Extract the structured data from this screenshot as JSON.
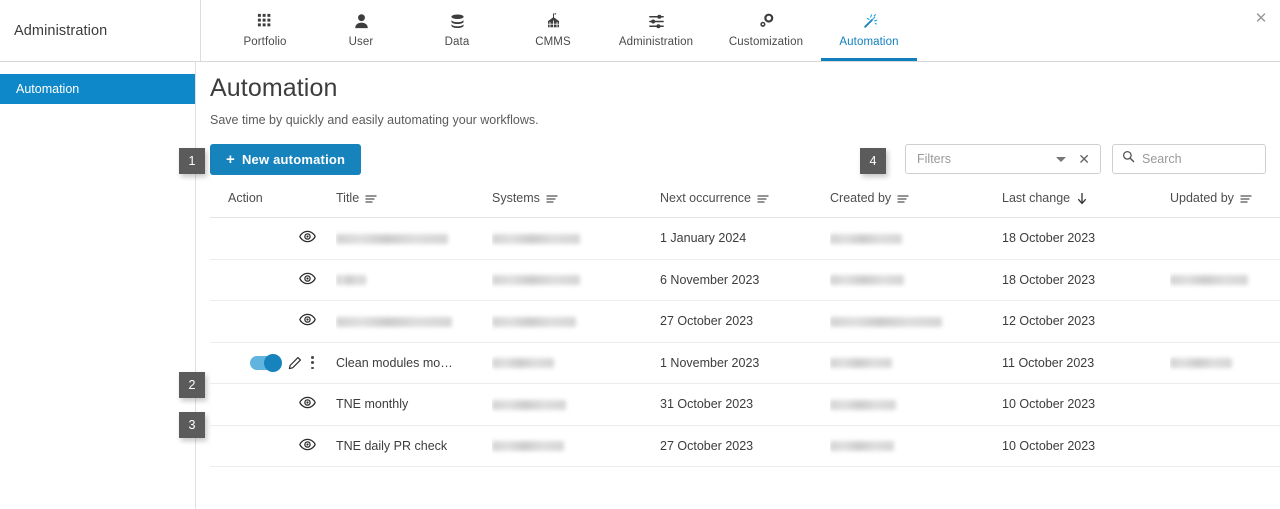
{
  "header": {
    "app_title": "Administration",
    "close_label": "✕",
    "tabs": [
      {
        "label": "Portfolio",
        "icon": "grid-icon",
        "active": false
      },
      {
        "label": "User",
        "icon": "user-icon",
        "active": false
      },
      {
        "label": "Data",
        "icon": "database-icon",
        "active": false
      },
      {
        "label": "CMMS",
        "icon": "factory-icon",
        "active": false
      },
      {
        "label": "Administration",
        "icon": "sliders-icon",
        "active": false
      },
      {
        "label": "Customization",
        "icon": "customize-icon",
        "active": false
      },
      {
        "label": "Automation",
        "icon": "magic-wand-icon",
        "active": true
      }
    ]
  },
  "sidebar": {
    "items": [
      {
        "label": "Automation",
        "active": true
      }
    ]
  },
  "page": {
    "title": "Automation",
    "subtitle": "Save time by quickly and easily automating your workflows."
  },
  "toolbar": {
    "new_automation_label": "New automation",
    "new_automation_plus": "+",
    "filters_placeholder": "Filters",
    "filters_clear_label": "✕",
    "search_placeholder": "Search"
  },
  "table": {
    "columns": [
      {
        "key": "action",
        "label": "Action",
        "sort": "none"
      },
      {
        "key": "title",
        "label": "Title",
        "sort": "menu"
      },
      {
        "key": "systems",
        "label": "Systems",
        "sort": "menu"
      },
      {
        "key": "next",
        "label": "Next occurrence",
        "sort": "menu"
      },
      {
        "key": "created",
        "label": "Created by",
        "sort": "menu"
      },
      {
        "key": "change",
        "label": "Last change",
        "sort": "desc"
      },
      {
        "key": "updated",
        "label": "Updated by",
        "sort": "menu"
      }
    ],
    "rows": [
      {
        "action": "view",
        "title": "",
        "title_redacted": true,
        "title_widths": [
          112
        ],
        "systems": "",
        "systems_redacted": true,
        "systems_widths": [
          88
        ],
        "next": "1 January 2024",
        "created": "",
        "created_redacted": true,
        "created_widths": [
          72
        ],
        "change": "18 October 2023",
        "updated": "",
        "updated_redacted": false,
        "updated_widths": []
      },
      {
        "action": "view",
        "title": "",
        "title_redacted": true,
        "title_widths": [
          30
        ],
        "systems": "",
        "systems_redacted": true,
        "systems_widths": [
          88
        ],
        "next": "6 November 2023",
        "created": "",
        "created_redacted": true,
        "created_widths": [
          74
        ],
        "change": "18 October 2023",
        "updated": "",
        "updated_redacted": true,
        "updated_widths": [
          78
        ]
      },
      {
        "action": "view",
        "title": "",
        "title_redacted": true,
        "title_widths": [
          116
        ],
        "systems": "",
        "systems_redacted": true,
        "systems_widths": [
          84
        ],
        "next": "27 October 2023",
        "created": "",
        "created_redacted": true,
        "created_widths": [
          112
        ],
        "change": "12 October 2023",
        "updated": "",
        "updated_redacted": false,
        "updated_widths": []
      },
      {
        "action": "toggle-edit-menu",
        "toggle_on": true,
        "title": "Clean modules mo…",
        "title_redacted": false,
        "title_widths": [],
        "systems": "",
        "systems_redacted": true,
        "systems_widths": [
          62
        ],
        "next": "1 November 2023",
        "created": "",
        "created_redacted": true,
        "created_widths": [
          62
        ],
        "change": "11 October 2023",
        "updated": "",
        "updated_redacted": true,
        "updated_widths": [
          62
        ]
      },
      {
        "action": "view",
        "title": "TNE monthly",
        "title_redacted": false,
        "title_widths": [],
        "systems": "",
        "systems_redacted": true,
        "systems_widths": [
          74
        ],
        "next": "31 October 2023",
        "created": "",
        "created_redacted": true,
        "created_widths": [
          66
        ],
        "change": "10 October 2023",
        "updated": "",
        "updated_redacted": false,
        "updated_widths": []
      },
      {
        "action": "view",
        "title": "TNE daily PR check",
        "title_redacted": false,
        "title_widths": [],
        "systems": "",
        "systems_redacted": true,
        "systems_widths": [
          72
        ],
        "next": "27 October 2023",
        "created": "",
        "created_redacted": true,
        "created_widths": [
          64
        ],
        "change": "10 October 2023",
        "updated": "",
        "updated_redacted": false,
        "updated_widths": []
      }
    ]
  },
  "annotations": [
    {
      "id": 1,
      "label": "1"
    },
    {
      "id": 2,
      "label": "2"
    },
    {
      "id": 3,
      "label": "3"
    },
    {
      "id": 4,
      "label": "4"
    }
  ],
  "colors": {
    "accent": "#1683bd",
    "sidebar_active": "#0e88c8",
    "tab_active": "#0f7fbf",
    "badge_bg": "#5b5b5b"
  }
}
